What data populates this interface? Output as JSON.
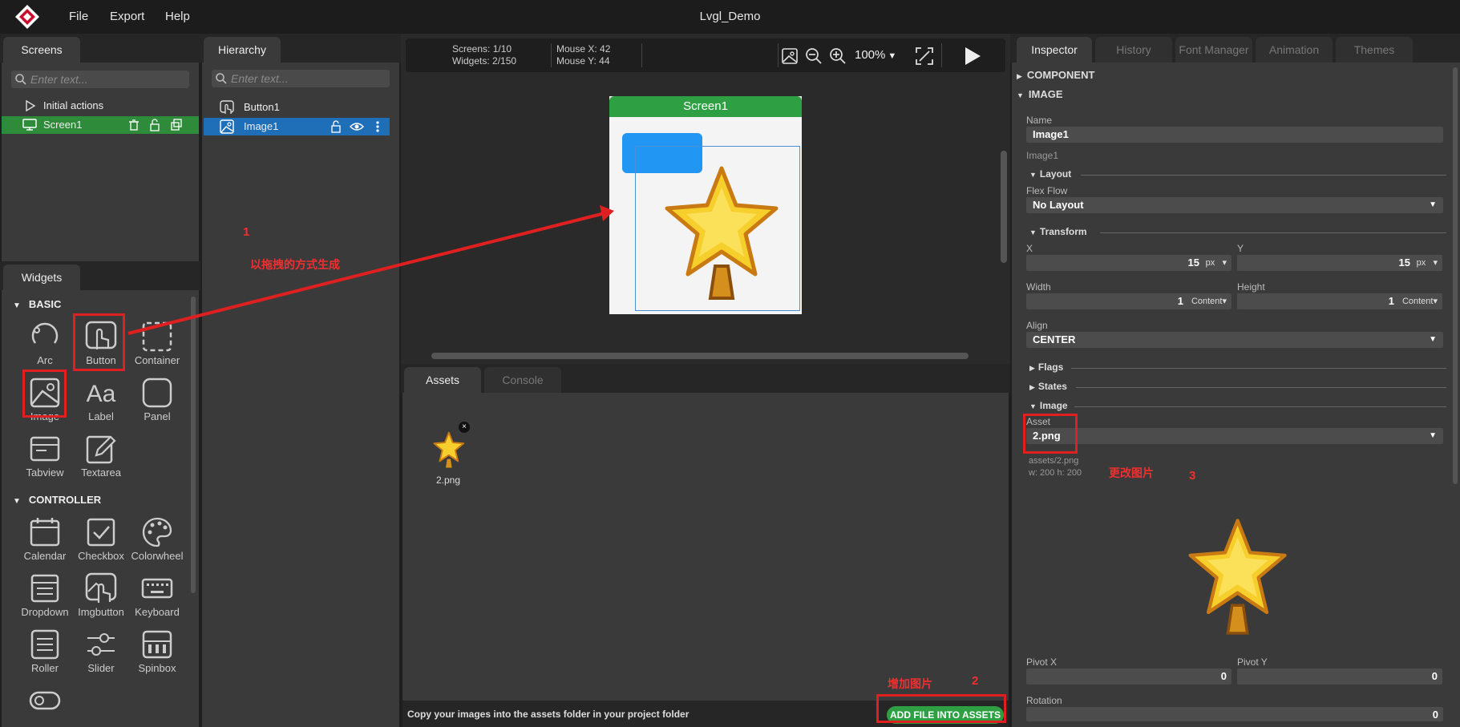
{
  "app": {
    "title": "Lvgl_Demo",
    "menu": [
      "File",
      "Export",
      "Help"
    ]
  },
  "screens_panel": {
    "tab": "Screens",
    "search_placeholder": "Enter text...",
    "items": [
      {
        "label": "Initial actions"
      },
      {
        "label": "Screen1"
      }
    ]
  },
  "hierarchy_panel": {
    "tab": "Hierarchy",
    "search_placeholder": "Enter text...",
    "items": [
      {
        "label": "Button1"
      },
      {
        "label": "Image1"
      }
    ]
  },
  "widgets_panel": {
    "tab": "Widgets",
    "sections": [
      {
        "title": "BASIC",
        "items": [
          "Arc",
          "Button",
          "Container",
          "Image",
          "Label",
          "Panel",
          "Tabview",
          "Textarea"
        ]
      },
      {
        "title": "CONTROLLER",
        "items": [
          "Calendar",
          "Checkbox",
          "Colorwheel",
          "Dropdown",
          "Imgbutton",
          "Keyboard",
          "Roller",
          "Slider",
          "Spinbox"
        ]
      }
    ]
  },
  "toolbar": {
    "screens": "Screens: 1/10",
    "widgets": "Widgets: 2/150",
    "mouse_x": "Mouse X: 42",
    "mouse_y": "Mouse Y: 44",
    "zoom": "100%"
  },
  "canvas": {
    "screen_title": "Screen1"
  },
  "bottom_panel": {
    "tabs": [
      "Assets",
      "Console"
    ],
    "asset_name": "2.png",
    "hint": "Copy your images into the assets folder in your project folder",
    "add_button": "ADD FILE INTO ASSETS"
  },
  "inspector": {
    "tabs": [
      "Inspector",
      "History",
      "Font Manager",
      "Animation",
      "Themes"
    ],
    "sections": {
      "component": "COMPONENT",
      "image": "IMAGE"
    },
    "name_label": "Name",
    "name_value": "Image1",
    "name_sub": "Image1",
    "layout_title": "Layout",
    "flex_flow_label": "Flex Flow",
    "flex_flow_value": "No Layout",
    "transform_title": "Transform",
    "x_label": "X",
    "x_value": "15",
    "y_label": "Y",
    "y_value": "15",
    "unit_px": "px",
    "width_label": "Width",
    "width_value": "1",
    "height_label": "Height",
    "height_value": "1",
    "unit_content": "Content",
    "align_label": "Align",
    "align_value": "CENTER",
    "flags_title": "Flags",
    "states_title": "States",
    "image_title": "Image",
    "asset_label": "Asset",
    "asset_value": "2.png",
    "asset_path": "assets/2.png",
    "asset_size": "w: 200  h: 200",
    "pivot_x_label": "Pivot X",
    "pivot_x_value": "0",
    "pivot_y_label": "Pivot Y",
    "pivot_y_value": "0",
    "rotation_label": "Rotation",
    "rotation_value": "0"
  },
  "annotations": {
    "note1_num": "1",
    "note1_text": "以拖拽的方式生成",
    "note2_num": "2",
    "note2_text": "增加图片",
    "note3_text": "更改图片",
    "note3_num": "3"
  },
  "colors": {
    "accent_green": "#2ea043",
    "selection_blue": "#1f6fb8",
    "annotation_red": "#e02020"
  }
}
